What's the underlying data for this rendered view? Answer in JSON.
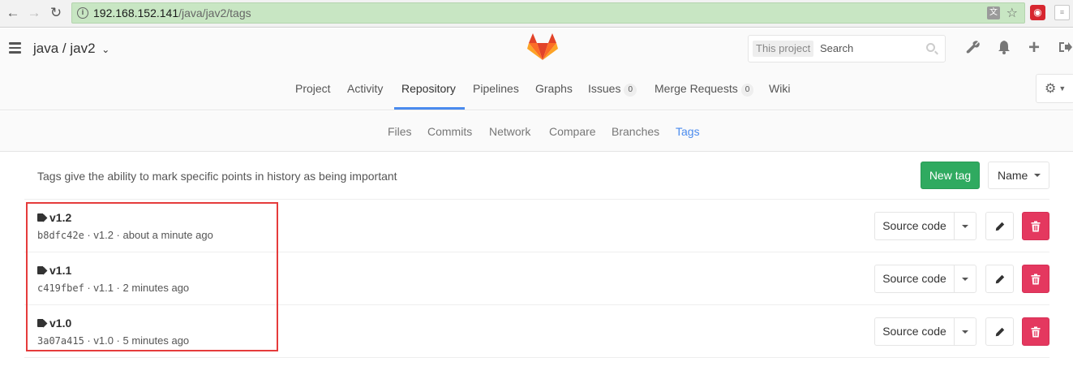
{
  "browser": {
    "url_host": "192.168.152.141",
    "url_path": "/java/jav2/tags",
    "icons": [
      "back-arrow",
      "forward-arrow",
      "reload",
      "info",
      "translate",
      "star",
      "extension"
    ]
  },
  "header": {
    "project_title": "java / jav2",
    "search": {
      "scope": "This project",
      "placeholder": "Search"
    },
    "icons": [
      "hamburger",
      "gitlab-logo",
      "wrench",
      "bell",
      "plus",
      "sign-out"
    ]
  },
  "tabs": [
    {
      "label": "Project"
    },
    {
      "label": "Activity"
    },
    {
      "label": "Repository"
    },
    {
      "label": "Pipelines"
    },
    {
      "label": "Graphs"
    },
    {
      "label": "Issues",
      "count": "0"
    },
    {
      "label": "Merge Requests",
      "count": "0"
    },
    {
      "label": "Wiki"
    }
  ],
  "active_tab": "Repository",
  "subnav": [
    "Files",
    "Commits",
    "Network",
    "Compare",
    "Branches",
    "Tags"
  ],
  "active_subnav": "Tags",
  "content": {
    "description": "Tags give the ability to mark specific points in history as being important",
    "new_tag_label": "New tag",
    "sort_label": "Name"
  },
  "tags": [
    {
      "name": "v1.2",
      "sha": "b8dfc42e",
      "message": "v1.2",
      "time": "about a minute ago",
      "source_label": "Source code"
    },
    {
      "name": "v1.1",
      "sha": "c419fbef",
      "message": "v1.1",
      "time": "2 minutes ago",
      "source_label": "Source code"
    },
    {
      "name": "v1.0",
      "sha": "3a07a415",
      "message": "v1.0",
      "time": "5 minutes ago",
      "source_label": "Source code"
    }
  ],
  "colors": {
    "accent": "#4a8bee",
    "new_tag_green": "#2faa60",
    "delete_red": "#e4385f",
    "highlight_border": "#e53b3b",
    "url_bar_green": "#c8e6c3"
  }
}
